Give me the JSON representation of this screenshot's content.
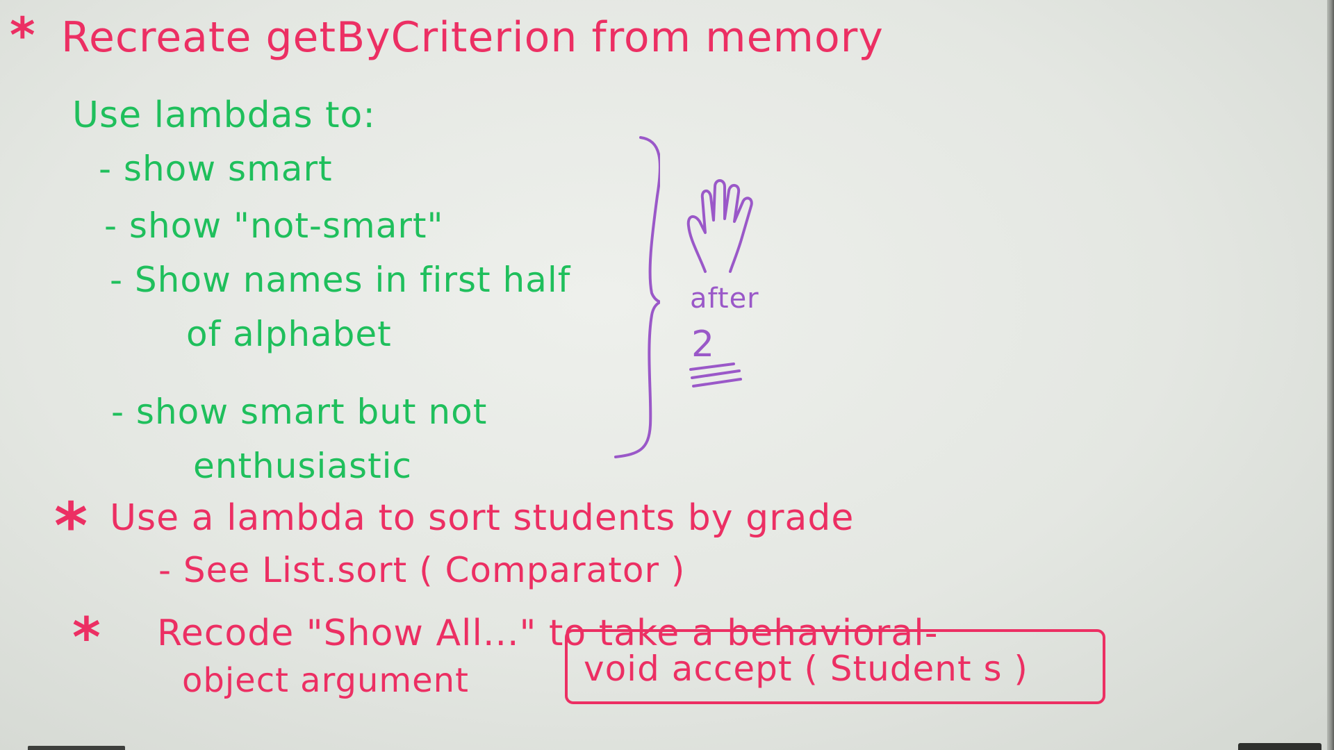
{
  "board": {
    "title_star": "*",
    "title": "Recreate getByCriterion from memory",
    "intro": "Use lambdas to:",
    "bullets": [
      "- show smart",
      "- show \"not-smart\"",
      "- Show names in first half",
      "of alphabet",
      "- show smart but not",
      "enthusiastic"
    ],
    "side_note": {
      "hand_icon": "raised-hand-icon",
      "after_label": "after",
      "number": "2"
    },
    "item2": {
      "star": "*",
      "text": "Use a lambda to sort students by grade",
      "sub": "- See List.sort ( Comparator )"
    },
    "item3": {
      "star": "*",
      "line1": "Recode \"Show All...\" to take a behavioral-",
      "line2": "object argument",
      "code": "void accept ( Student s )"
    },
    "colors": {
      "red_marker": "#ec2f63",
      "green_marker": "#1fbf5c",
      "purple_marker": "#9a58c8"
    }
  }
}
